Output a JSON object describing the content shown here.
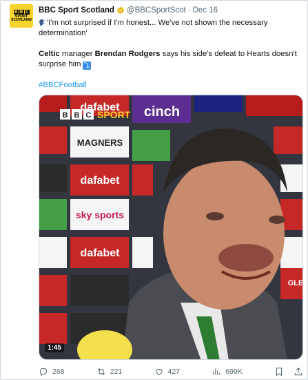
{
  "account": {
    "avatar_label": "BBC",
    "avatar_sub": "SPORT SCOTLAND",
    "name": "BBC Sport Scotland",
    "handle": "@BBCSportScot",
    "separator": "·",
    "date": "Dec 16"
  },
  "tweet": {
    "line1": "'I'm not surprised if I'm honest... We've not shown the necessary",
    "line2": "determination'",
    "p2_a": "Celtic",
    "p2_b": " manager ",
    "p2_c": "Brendan Rodgers",
    "p2_d": " says his side's defeat to Hearts doesn't",
    "p2_line2": "surprise him",
    "emoji": "⤵",
    "hashtag": "#BBCFootball"
  },
  "media": {
    "overlay_logo": "BBC SPORT",
    "duration": "1:45",
    "board_texts": [
      "dafabet",
      "MAGNERS",
      "cinch",
      "sky sports",
      "GLE"
    ]
  },
  "actions": {
    "replies": "268",
    "reposts": "221",
    "likes": "427",
    "views": "699K"
  },
  "colors": {
    "accent": "#1d9bf0",
    "verified": "#e8b913",
    "avatar_bg": "#f6d32d"
  }
}
